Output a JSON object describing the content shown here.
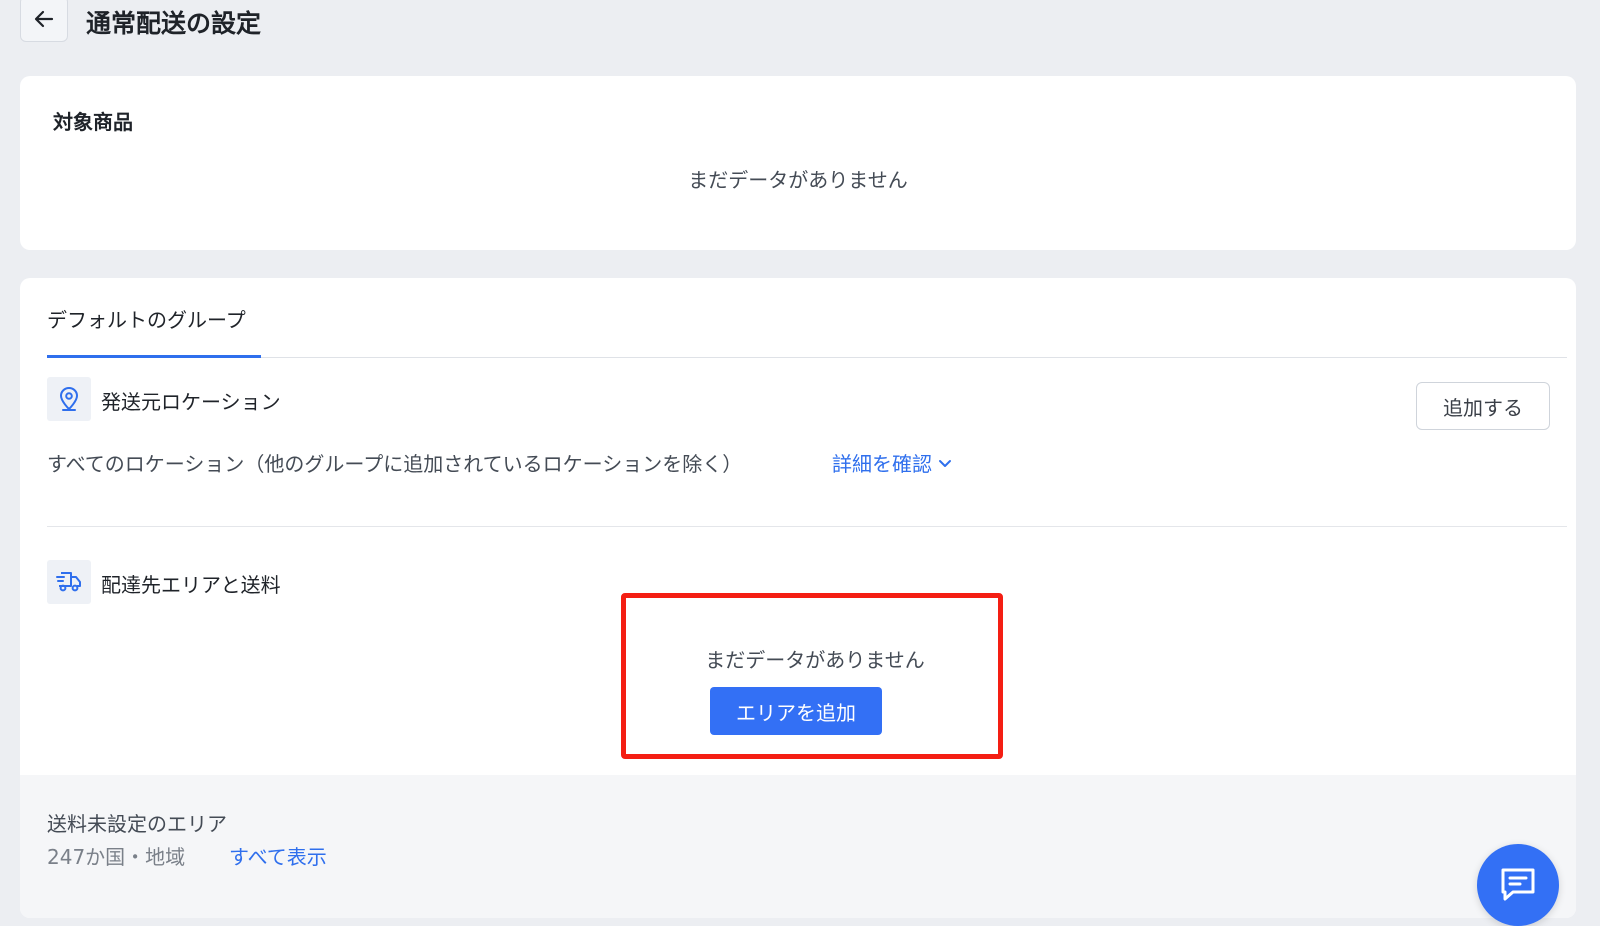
{
  "header": {
    "title": "通常配送の設定",
    "back_icon": "arrow-left-icon"
  },
  "target_products": {
    "label": "対象商品",
    "empty_text": "まだデータがありません"
  },
  "group": {
    "tab_label": "デフォルトのグループ",
    "origin": {
      "icon": "location-pin-icon",
      "title": "発送元ロケーション",
      "add_button": "追加する",
      "description": "すべてのロケーション（他のグループに追加されているロケーションを除く）",
      "detail_link": "詳細を確認"
    },
    "destination": {
      "icon": "delivery-truck-icon",
      "title": "配達先エリアと送料",
      "empty_text": "まだデータがありません",
      "add_area_button": "エリアを追加"
    },
    "unset_areas": {
      "title": "送料未設定のエリア",
      "count_text": "247か国・地域",
      "show_all_link": "すべて表示"
    }
  },
  "colors": {
    "accent": "#3370f5",
    "link": "#2f6fed",
    "highlight": "#f41e13",
    "background": "#eceef2"
  },
  "chat_button_icon": "chat-icon"
}
